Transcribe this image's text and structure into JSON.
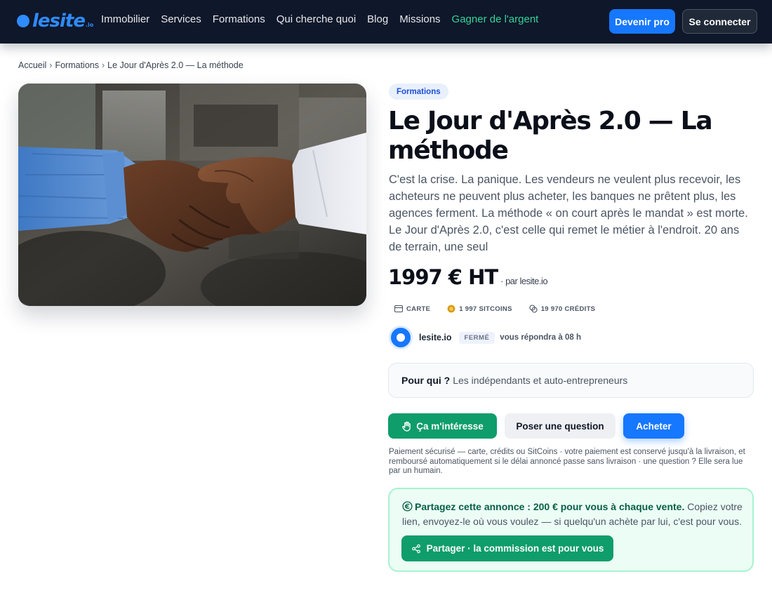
{
  "brand": {
    "name": "lesite",
    "tld": ".io"
  },
  "nav": {
    "items": [
      {
        "label": "Immobilier"
      },
      {
        "label": "Services"
      },
      {
        "label": "Formations"
      },
      {
        "label": "Qui cherche quoi"
      },
      {
        "label": "Blog"
      },
      {
        "label": "Missions"
      },
      {
        "label": "Gagner de l'argent"
      }
    ],
    "pro_button": "Devenir pro",
    "login_button": "Se connecter"
  },
  "breadcrumb": {
    "items": [
      {
        "label": "Accueil"
      },
      {
        "label": "Formations"
      },
      {
        "label": "Le Jour d'Après 2.0 — La méthode"
      }
    ],
    "separator": "›"
  },
  "product": {
    "category_badge": "Formations",
    "title": "Le Jour d'Après 2.0 — La méthode",
    "description": "C'est la crise. La panique. Les vendeurs ne veulent plus recevoir, les acheteurs ne peuvent plus acheter, les banques ne prêtent plus, les agences ferment. La méthode « on court après le mandat » est morte. Le Jour d'Après 2.0, c'est celle qui remet le métier à l'endroit. 20 ans de terrain, une seul",
    "price": "1997 € HT",
    "price_by": "· par lesite.io",
    "payment_options": [
      {
        "label": "CARTE",
        "icon": "card-icon"
      },
      {
        "label": "1 997 SITCOINS",
        "icon": "coin-icon"
      },
      {
        "label": "19 970 CRÉDITS",
        "icon": "credits-icon"
      }
    ]
  },
  "seller": {
    "name": "lesite.io",
    "status": "FERMÉ",
    "reply_text": "vous répondra à 08 h"
  },
  "audience": {
    "label": "Pour qui ?",
    "value": "Les indépendants et auto-entrepreneurs"
  },
  "actions": {
    "interest": "Ça m'intéresse",
    "question": "Poser une question",
    "buy": "Acheter"
  },
  "secure_note": "Paiement sécurisé — carte, crédits ou SitCoins · votre paiement est conservé jusqu'à la livraison, et remboursé automatiquement si le délai annoncé passe sans livraison · une question ? Elle sera lue par un humain.",
  "share": {
    "headline": "Partagez cette annonce : 200 € pour vous à chaque vente.",
    "body": " Copiez votre lien, envoyez-le où vous voulez — si quelqu'un achète par lui, c'est pour vous.",
    "button": "Partager · la commission est pour vous"
  },
  "colors": {
    "nav_bg": "#0f172a",
    "brand_blue": "#2f8bff",
    "primary": "#1677ff",
    "success": "#0f9d6b",
    "nav_accent": "#34d399"
  }
}
